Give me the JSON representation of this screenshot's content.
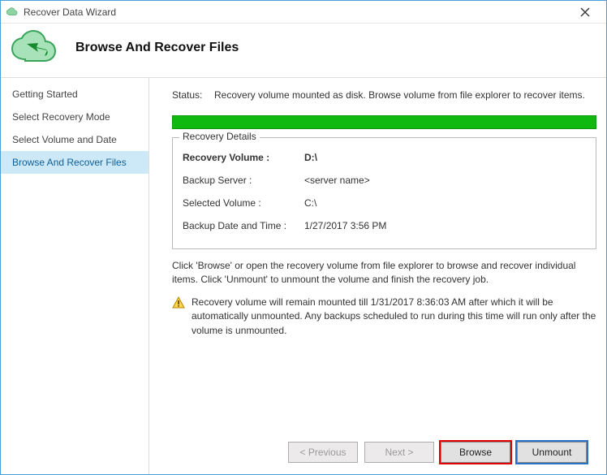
{
  "window": {
    "title": "Recover Data Wizard"
  },
  "header": {
    "page_title": "Browse And Recover Files"
  },
  "sidebar": {
    "items": [
      {
        "label": "Getting Started",
        "active": false
      },
      {
        "label": "Select Recovery Mode",
        "active": false
      },
      {
        "label": "Select Volume and Date",
        "active": false
      },
      {
        "label": "Browse And Recover Files",
        "active": true
      }
    ]
  },
  "status": {
    "label": "Status:",
    "text": "Recovery volume mounted as disk. Browse volume from file explorer to recover items."
  },
  "progress": {
    "percent": 100,
    "color": "#0fb90f"
  },
  "details": {
    "legend": "Recovery Details",
    "rows": [
      {
        "label": "Recovery Volume :",
        "value": "D:\\",
        "bold": true
      },
      {
        "label": "Backup Server :",
        "value": "<server name>",
        "bold": false
      },
      {
        "label": "Selected Volume :",
        "value": "C:\\",
        "bold": false
      },
      {
        "label": "Backup Date and Time :",
        "value": "1/27/2017 3:56 PM",
        "bold": false
      }
    ]
  },
  "hint": "Click 'Browse' or open the recovery volume from file explorer to browse and recover individual items. Click 'Unmount' to unmount the volume and finish the recovery job.",
  "warning": "Recovery volume will remain mounted till 1/31/2017 8:36:03 AM after which it will be automatically unmounted. Any backups scheduled to run during this time will run only after the volume is unmounted.",
  "footer": {
    "previous": "< Previous",
    "next": "Next >",
    "browse": "Browse",
    "unmount": "Unmount"
  }
}
